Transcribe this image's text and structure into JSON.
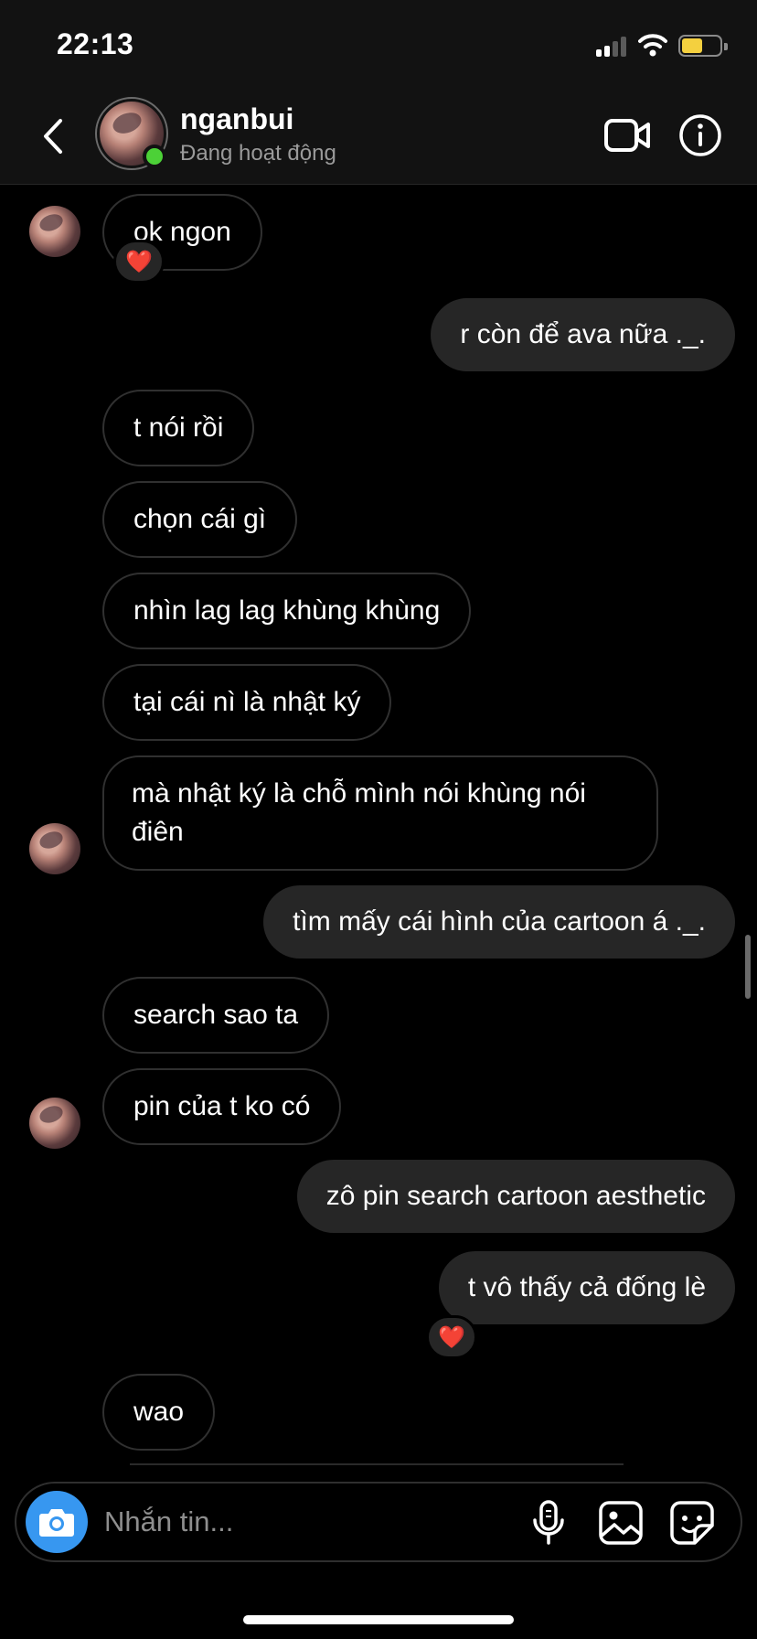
{
  "status_bar": {
    "time": "22:13"
  },
  "header": {
    "contact_name": "nganbui",
    "contact_status": "Đang hoạt động"
  },
  "messages": [
    {
      "text": "ok ngon",
      "direction": "in",
      "reaction": "❤️"
    },
    {
      "text": "r còn để ava nữa ._.",
      "direction": "out"
    },
    {
      "text": "t nói rồi",
      "direction": "in"
    },
    {
      "text": "chọn cái gì",
      "direction": "in"
    },
    {
      "text": "nhìn lag lag khùng khùng",
      "direction": "in"
    },
    {
      "text": "tại cái nì là nhật ký",
      "direction": "in"
    },
    {
      "text": "mà nhật ký là chỗ mình nói khùng nói điên",
      "direction": "in"
    },
    {
      "text": "tìm mấy cái hình của cartoon á ._.",
      "direction": "out"
    },
    {
      "text": "search sao ta",
      "direction": "in"
    },
    {
      "text": "pin của t ko có",
      "direction": "in"
    },
    {
      "text": "zô pin search cartoon aesthetic",
      "direction": "out"
    },
    {
      "text": "t vô thấy cả đống lè",
      "direction": "out",
      "reaction": "❤️"
    },
    {
      "text": "wao",
      "direction": "in"
    }
  ],
  "composer": {
    "placeholder": "Nhắn tin..."
  },
  "colors": {
    "accent": "#3797f0",
    "online": "#4cd137",
    "reaction": "#ff3040",
    "outgoing_bubble": "#262626"
  }
}
